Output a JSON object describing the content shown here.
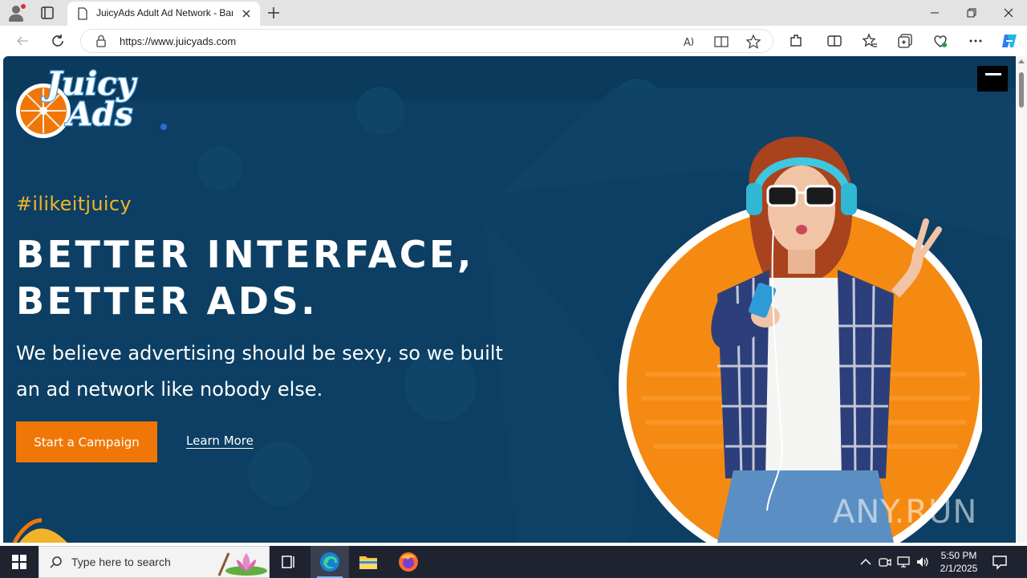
{
  "browser": {
    "tab_title": "JuicyAds Adult Ad Network - Banner",
    "url": "https://www.juicyads.com"
  },
  "page": {
    "brand": "JuicyAds",
    "hashtag": "#ilikeitjuicy",
    "headline_line1": "BETTER INTERFACE,",
    "headline_line2": "BETTER ADS.",
    "subheading": "We believe advertising should be sexy, so we built an ad network like nobody else.",
    "cta_label": "Start a Campaign",
    "learn_more_label": "Learn More",
    "watermark": "ANY.RUN"
  },
  "taskbar": {
    "search_placeholder": "Type here to search",
    "time": "5:50 PM",
    "date": "2/1/2025"
  },
  "colors": {
    "page_background": "#0a3a5c",
    "accent_orange": "#f07707",
    "hashtag_yellow": "#f2b32b"
  }
}
